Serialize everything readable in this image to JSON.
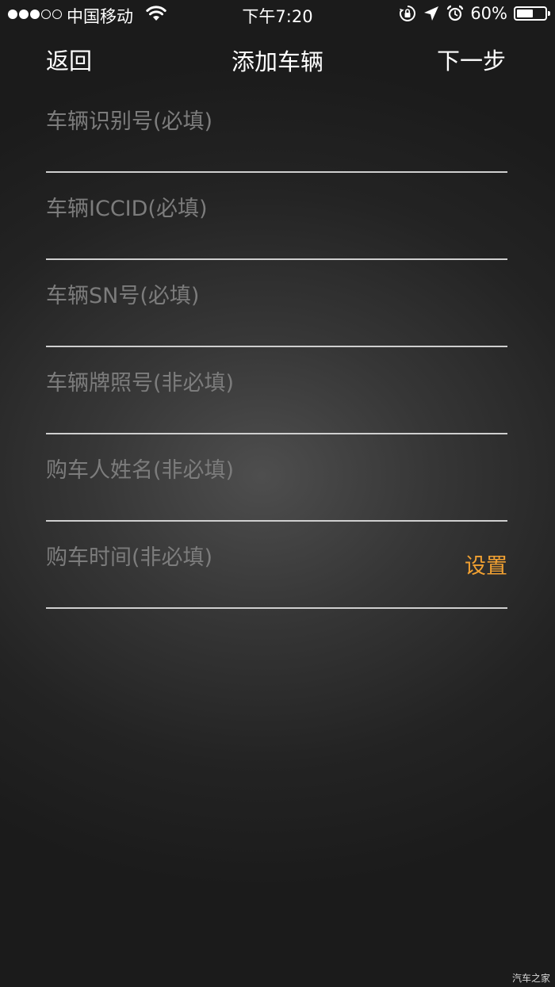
{
  "status_bar": {
    "carrier": "中国移动",
    "time": "下午7:20",
    "battery_percent": "60%",
    "battery_level": 0.6,
    "signal_bars_filled": 3,
    "signal_bars_total": 5,
    "icons": [
      "wifi-icon",
      "rotation-lock-icon",
      "location-arrow-icon",
      "alarm-icon",
      "battery-icon"
    ]
  },
  "nav": {
    "back_label": "返回",
    "title": "添加车辆",
    "next_label": "下一步"
  },
  "form": {
    "fields": [
      {
        "placeholder": "车辆识别号(必填)",
        "value": ""
      },
      {
        "placeholder": "车辆ICCID(必填)",
        "value": ""
      },
      {
        "placeholder": "车辆SN号(必填)",
        "value": ""
      },
      {
        "placeholder": "车辆牌照号(非必填)",
        "value": ""
      },
      {
        "placeholder": "购车人姓名(非必填)",
        "value": ""
      },
      {
        "placeholder": "购车时间(非必填)",
        "value": "",
        "action_label": "设置"
      }
    ]
  },
  "watermark": "汽车之家",
  "colors": {
    "accent": "#f0a032",
    "placeholder": "#7c7c7c",
    "divider": "#cfcfcf"
  }
}
